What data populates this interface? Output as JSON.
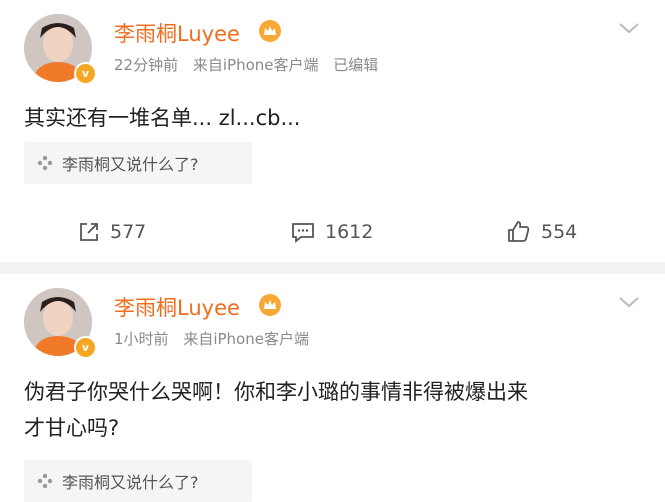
{
  "posts": [
    {
      "username": "李雨桐Luyee",
      "time": "22分钟前",
      "source": "来自iPhone客户端",
      "edited": "已编辑",
      "content": "其实还有一堆名单... zl...cb...",
      "topic": "李雨桐又说什么了?",
      "reposts": "577",
      "comments": "1612",
      "likes": "554"
    },
    {
      "username": "李雨桐Luyee",
      "time": "1小时前",
      "source": "来自iPhone客户端",
      "content_line1": "伪君子你哭什么哭啊！你和李小璐的事情非得被爆出来",
      "content_line2": "才甘心吗?",
      "topic": "李雨桐又说什么了?"
    }
  ],
  "verified_badge": "v",
  "colors": {
    "username": "#f06c1e",
    "crown": "#f7a935",
    "meta": "#8a8a8a",
    "background": "#f2f2f2"
  },
  "icons": [
    "crown-icon",
    "chevron-down-icon",
    "topic-icon",
    "repost-icon",
    "comment-icon",
    "like-icon"
  ]
}
